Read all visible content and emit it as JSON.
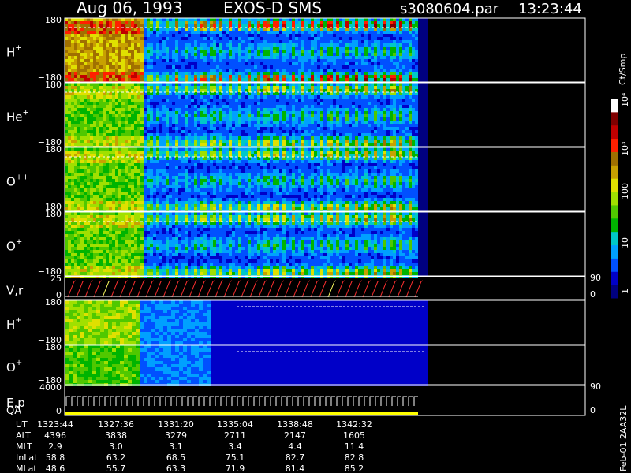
{
  "header": {
    "date": "Aug 06, 1993",
    "instrument": "EXOS-D SMS",
    "file": "s3080604.par",
    "time": "13:23:44"
  },
  "colorbar": {
    "unit_label": "Ct/Smp",
    "ticks": [
      "1",
      "10",
      "100",
      "10³",
      "10⁴"
    ],
    "colors": [
      "#000080",
      "#0000c8",
      "#0050ff",
      "#00a0ff",
      "#00c8c8",
      "#00b400",
      "#50c800",
      "#a0e000",
      "#e0e000",
      "#c8a000",
      "#a07000",
      "#ff2000",
      "#c00000",
      "#800000",
      "#ffffff"
    ]
  },
  "panels": [
    {
      "id": "h-plus-pitch",
      "label": "H",
      "sup": "+",
      "ticks": [
        "180",
        "−180"
      ]
    },
    {
      "id": "he-plus-pitch",
      "label": "He",
      "sup": "+",
      "ticks": [
        "180",
        "−180"
      ]
    },
    {
      "id": "o-plusplus-pitch",
      "label": "O",
      "sup": "++",
      "ticks": [
        "180",
        "−180"
      ]
    },
    {
      "id": "o-plus-pitch",
      "label": "O",
      "sup": "+",
      "ticks": [
        "180",
        "−180"
      ]
    },
    {
      "id": "vr",
      "label": "V,r",
      "sup": "",
      "ticks": [
        "25",
        "0"
      ],
      "right_ticks": [
        "90",
        "0"
      ]
    },
    {
      "id": "h-plus-lower",
      "label": "H",
      "sup": "+",
      "ticks": [
        "180",
        "−180"
      ]
    },
    {
      "id": "o-plus-lower",
      "label": "O",
      "sup": "+",
      "ticks": [
        "180",
        "−180"
      ]
    },
    {
      "id": "ep-qa",
      "label": "E,p",
      "label2": "QA",
      "ticks": [
        "4000",
        "0"
      ],
      "right_ticks": [
        "90",
        "0"
      ]
    }
  ],
  "footer_rows": [
    {
      "label": "UT",
      "values": [
        "1323:44",
        "1327:36",
        "1331:20",
        "1335:04",
        "1338:48",
        "1342:32"
      ]
    },
    {
      "label": "ALT",
      "values": [
        "4396",
        "3838",
        "3279",
        "2711",
        "2147",
        "1605"
      ]
    },
    {
      "label": "MLT",
      "values": [
        "2.9",
        "3.0",
        "3.1",
        "3.4",
        "4.4",
        "11.4"
      ]
    },
    {
      "label": "InLat",
      "values": [
        "58.8",
        "63.2",
        "68.5",
        "75.1",
        "82.7",
        "82.8"
      ]
    },
    {
      "label": "MLat",
      "values": [
        "48.6",
        "55.7",
        "63.3",
        "71.9",
        "81.4",
        "85.2"
      ]
    }
  ],
  "side_label": "Feb-01 2AA32L",
  "chart_data": {
    "type": "heatmap",
    "title": "Aug 06, 1993   EXOS-D SMS",
    "x": [
      "1323:44",
      "1327:36",
      "1331:20",
      "1335:04",
      "1338:48",
      "1342:32"
    ],
    "xlabel": "UT",
    "colorbar_label": "Ct/Smp",
    "colorbar_ticks": [
      1,
      10,
      100,
      1000,
      10000
    ],
    "y_range_pitch": [
      -180,
      180
    ],
    "grid": false
  }
}
